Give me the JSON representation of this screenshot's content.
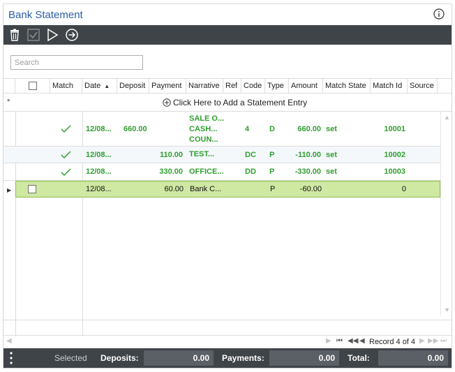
{
  "window": {
    "title": "Bank Statement"
  },
  "search": {
    "placeholder": "Search"
  },
  "columns": {
    "match": "Match",
    "date": "Date",
    "deposit": "Deposit",
    "payment": "Payment",
    "narrative": "Narrative",
    "ref": "Ref",
    "code": "Code",
    "type": "Type",
    "amount": "Amount",
    "match_state": "Match State",
    "match_id": "Match Id",
    "source": "Source"
  },
  "new_row": {
    "marker": "*",
    "label": "Click Here to Add a Statement Entry"
  },
  "rows": [
    {
      "matched": true,
      "date": "12/08...",
      "deposit": "660.00",
      "payment": "",
      "narrative_lines": [
        "SALE O...",
        "CASH...",
        "COUN..."
      ],
      "ref": "",
      "code": "4",
      "type": "D",
      "amount": "660.00",
      "match_state": "set",
      "match_id": "10001",
      "source": ""
    },
    {
      "matched": true,
      "date": "12/08...",
      "deposit": "",
      "payment": "110.00",
      "narrative_lines": [
        "TEST..."
      ],
      "ref": "",
      "code": "DC",
      "type": "P",
      "amount": "-110.00",
      "match_state": "set",
      "match_id": "10002",
      "source": ""
    },
    {
      "matched": true,
      "date": "12/08...",
      "deposit": "",
      "payment": "330.00",
      "narrative_lines": [
        "OFFICE..."
      ],
      "ref": "",
      "code": "DD",
      "type": "P",
      "amount": "-330.00",
      "match_state": "set",
      "match_id": "10003",
      "source": ""
    },
    {
      "matched": false,
      "date": "12/08...",
      "deposit": "",
      "payment": "60.00",
      "narrative_lines": [
        "Bank C..."
      ],
      "ref": "",
      "code": "",
      "type": "P",
      "amount": "-60.00",
      "match_state": "",
      "match_id": "0",
      "source": ""
    }
  ],
  "pager": {
    "record_text": "Record 4 of 4"
  },
  "footer": {
    "selected_label": "Selected",
    "deposits_label": "Deposits:",
    "deposits_value": "0.00",
    "payments_label": "Payments:",
    "payments_value": "0.00",
    "total_label": "Total:",
    "total_value": "0.00"
  },
  "colors": {
    "title_blue": "#2a5ea8",
    "toolbar_bg": "#3f4449",
    "matched_green": "#2f9e2f",
    "selected_row_bg": "#cfe8a2"
  },
  "icons": {
    "info": "info-icon",
    "delete": "trash-icon",
    "approve": "check-box-icon",
    "run": "play-icon",
    "go": "arrow-right-circle-icon",
    "add": "plus-circle-icon",
    "match": "checkmark-icon",
    "more": "vertical-dots-icon"
  }
}
